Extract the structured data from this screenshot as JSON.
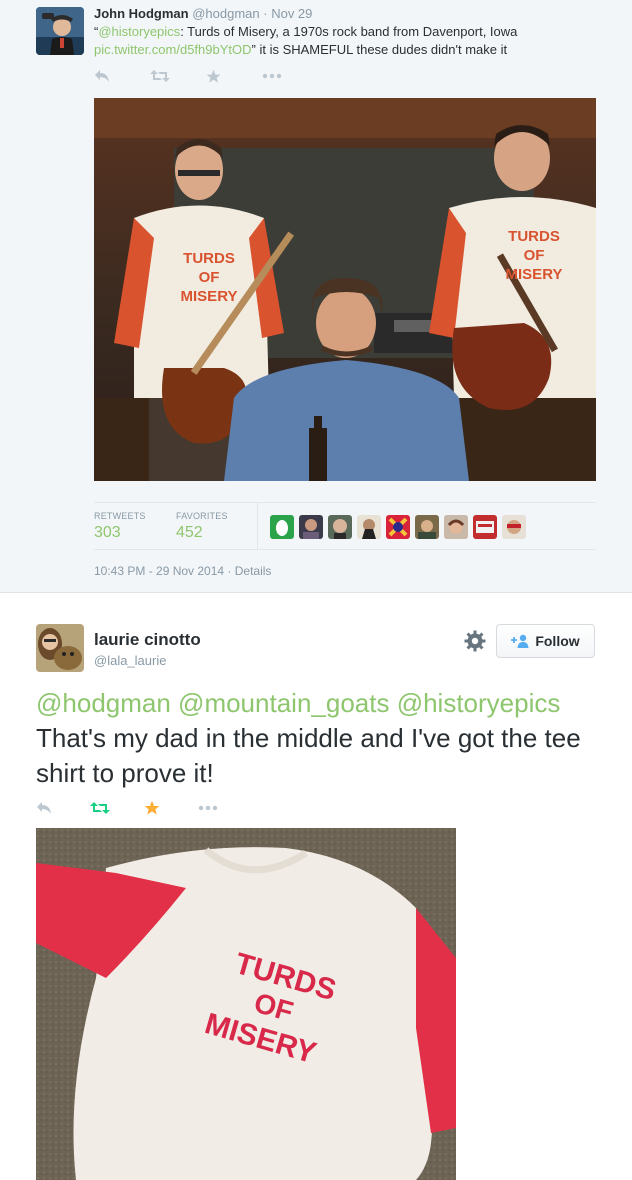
{
  "tweet1": {
    "name": "John Hodgman",
    "handle": "@hodgman",
    "date": "· Nov 29",
    "text_open_quote": "“",
    "text_mention": "@historyepics",
    "text_body1": ": Turds of Misery, a 1970s rock band from Davenport, Iowa",
    "text_link": "pic.twitter.com/d5fh9bYtOD",
    "text_body2": "” it is SHAMEFUL these dudes didn't make it",
    "photo_shirt_text": [
      "TURDS",
      "OF",
      "MISERY"
    ],
    "stats": {
      "retweets_label": "RETWEETS",
      "retweets_value": "303",
      "favorites_label": "FAVORITES",
      "favorites_value": "452"
    },
    "timestamp": "10:43 PM - 29 Nov 2014",
    "details_link": "· Details"
  },
  "tweet2": {
    "name": "laurie cinotto",
    "handle": "@lala_laurie",
    "follow_label": "Follow",
    "mentions": [
      "@hodgman",
      "@mountain_goats",
      "@historyepics"
    ],
    "text": "That's my dad in the middle and I've got the tee shirt to prove it!",
    "photo_shirt_text": [
      "TURDS",
      "OF",
      "MISERY"
    ]
  },
  "icons": [
    "reply-icon",
    "retweet-icon",
    "favorite-icon",
    "more-icon",
    "gear-icon",
    "follow-person-icon"
  ],
  "colors": {
    "accent": "#8ec66e",
    "favorite_active": "#ffac33",
    "retweet_active": "#19cf86",
    "muted": "#8899a6"
  }
}
